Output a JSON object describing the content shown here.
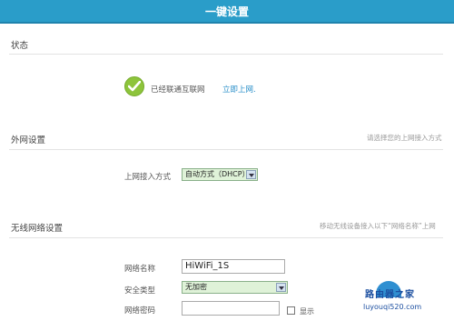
{
  "header": {
    "title": "一键设置"
  },
  "status_section": {
    "title": "状态",
    "status_text": "已经联通互联网",
    "action_link": "立即上网."
  },
  "wan_section": {
    "title": "外网设置",
    "hint": "请选择您的上网接入方式",
    "mode_label": "上网接入方式",
    "mode_selected": "自动方式（DHCP）"
  },
  "wifi_section": {
    "title": "无线网络设置",
    "hint": "移动无线设备接入以下“网络名称”上网",
    "ssid_label": "网络名称",
    "ssid_value": "HiWiFi_1S",
    "security_label": "安全类型",
    "security_selected": "无加密",
    "password_label": "网络密码",
    "password_value": "",
    "show_label": "显示"
  },
  "watermark": {
    "top": "路由器之家",
    "url": "luyouqi520.com"
  },
  "colors": {
    "header_bg": "#2a9dc9",
    "link": "#2a8fc9",
    "success": "#8dc43b",
    "select_bg": "#dff2d8"
  }
}
